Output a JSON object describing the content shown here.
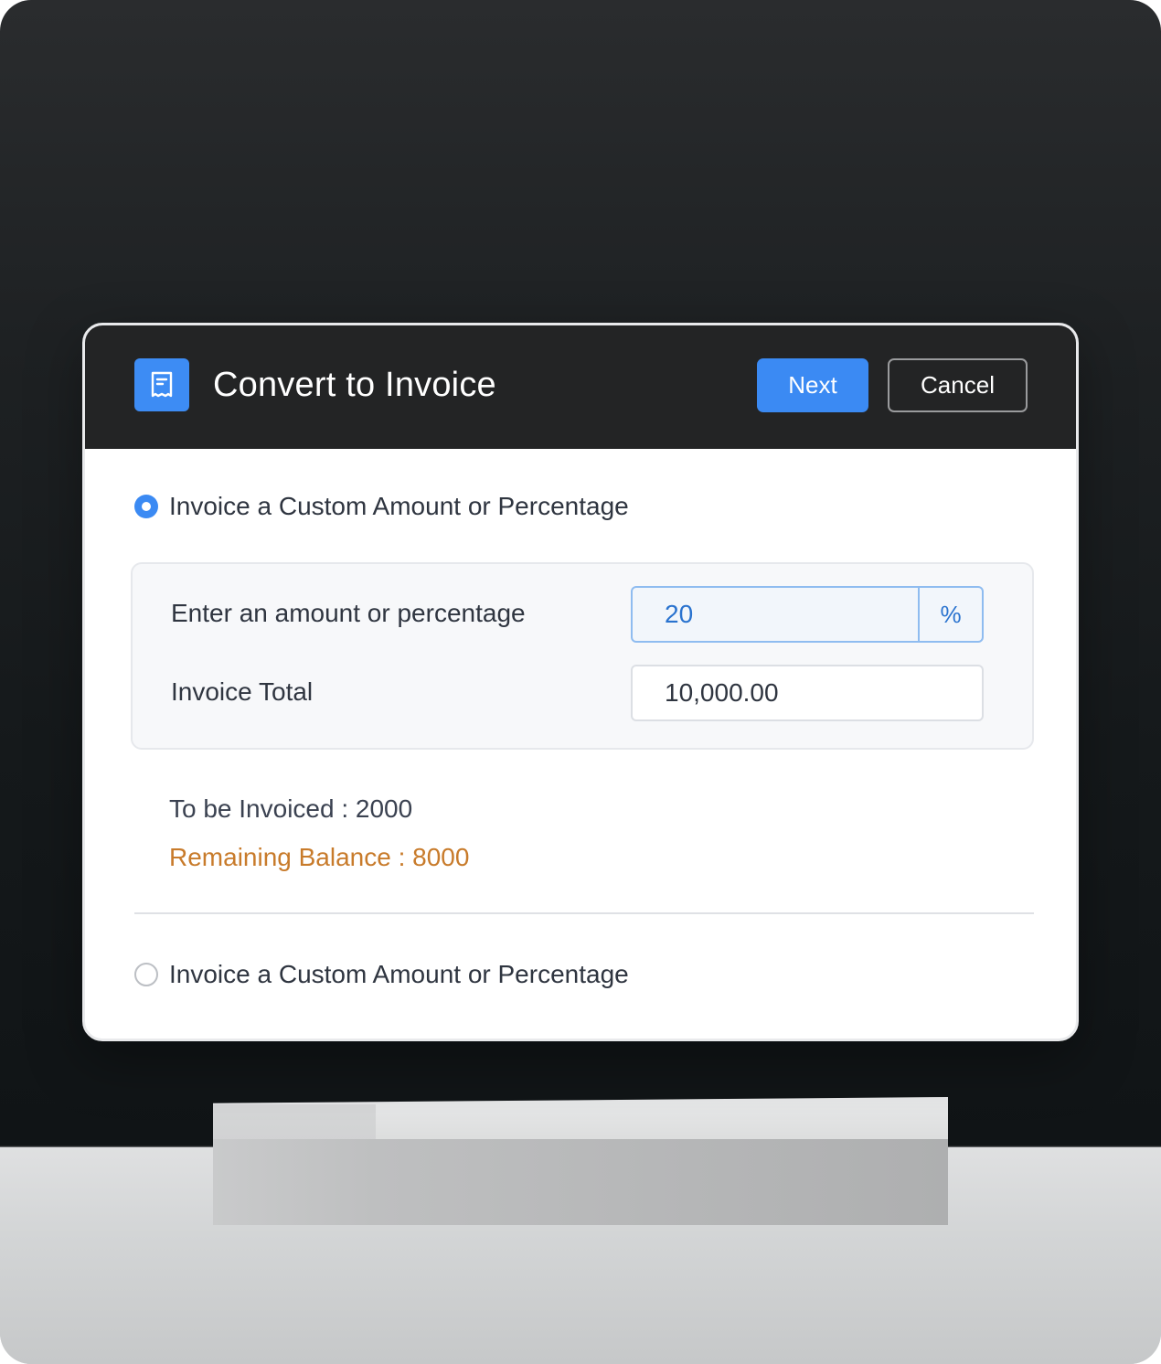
{
  "dialog": {
    "title": "Convert to Invoice",
    "icon": "receipt-icon",
    "next_label": "Next",
    "cancel_label": "Cancel"
  },
  "options": [
    {
      "label": "Invoice a Custom Amount or Percentage",
      "selected": true
    },
    {
      "label": "Invoice a Custom Amount or Percentage",
      "selected": false
    }
  ],
  "form": {
    "amount_label": "Enter an amount or percentage",
    "amount_value": "20",
    "amount_suffix": "%",
    "total_label": "Invoice Total",
    "total_value": "10,000.00"
  },
  "summary": {
    "to_be_invoiced": "To be Invoiced : 2000",
    "remaining_balance": "Remaining Balance : 8000"
  },
  "colors": {
    "accent": "#3b8af3",
    "header_bg": "#232425",
    "remaining_text": "#c87b2b"
  }
}
